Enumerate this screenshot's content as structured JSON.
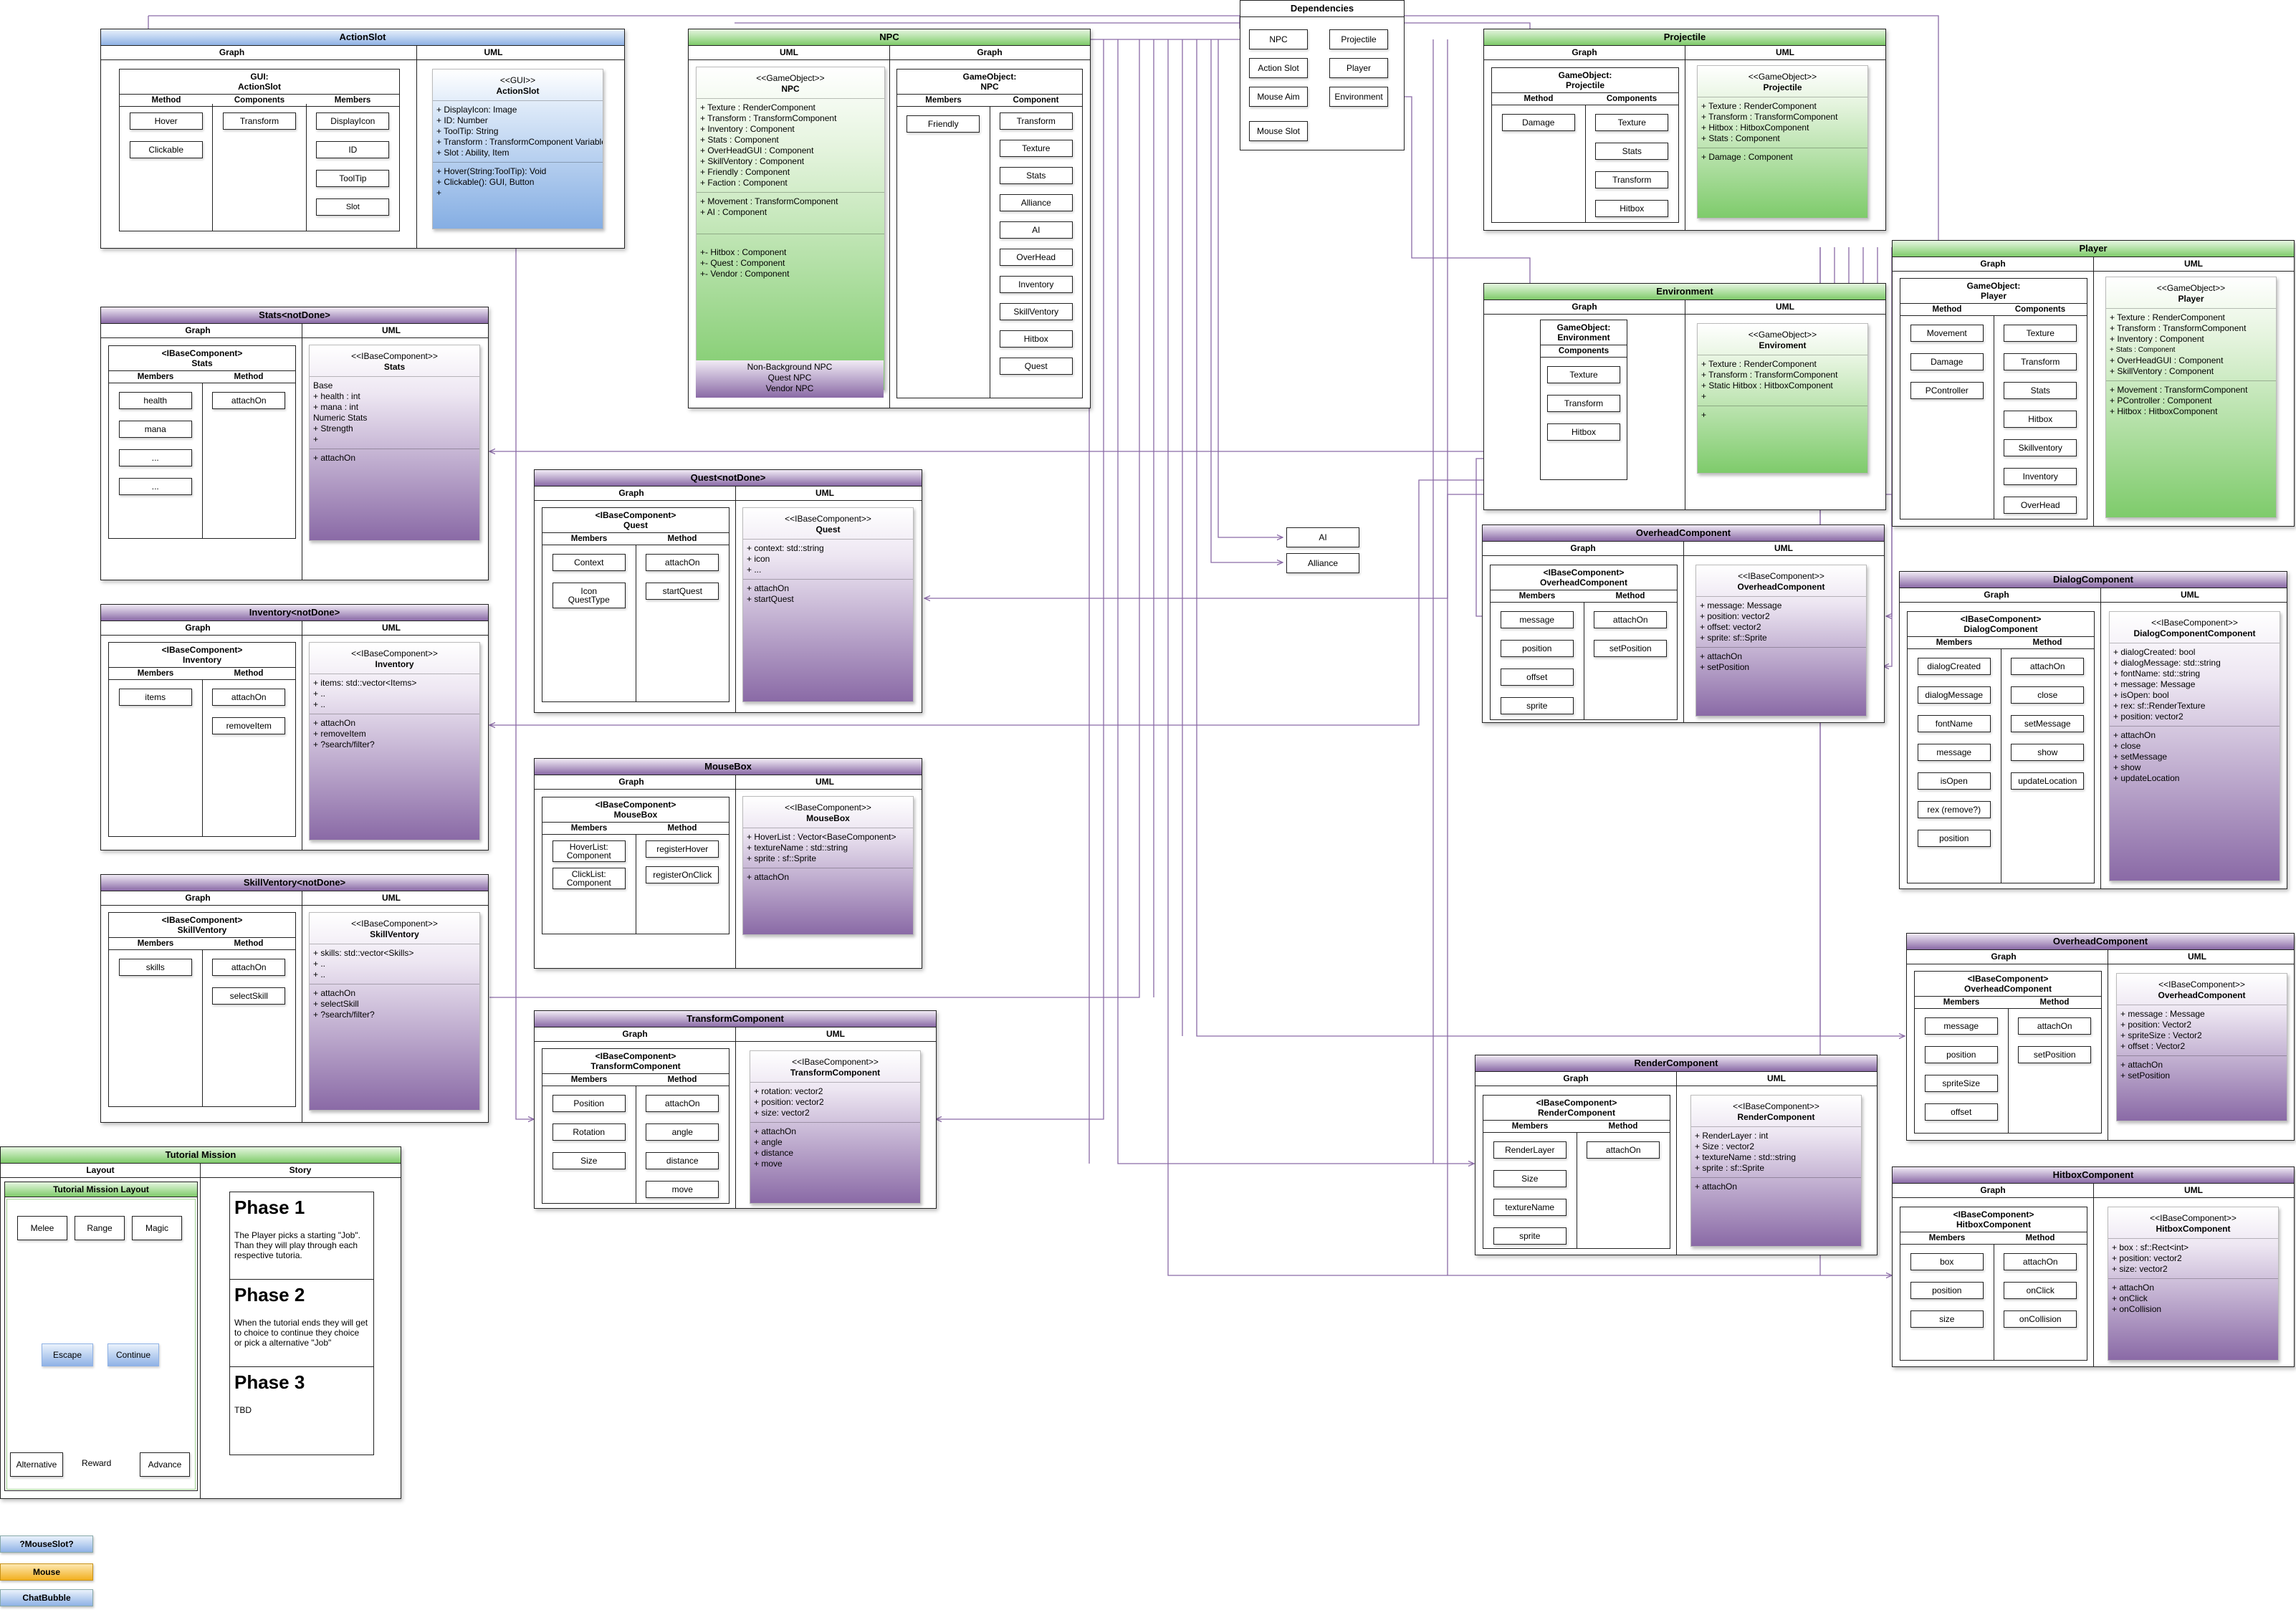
{
  "common": {
    "graph": "Graph",
    "uml": "UML",
    "layout": "Layout",
    "story": "Story"
  },
  "heads": {
    "method": "Method",
    "components": "Components",
    "members": "Members",
    "component": "Component"
  },
  "actionslot": {
    "title": "ActionSlot",
    "table_title": "GUI:\nActionSlot",
    "methods": [
      "Hover",
      "Clickable"
    ],
    "components": [
      "Transform"
    ],
    "members": [
      "DisplayIcon",
      "ID",
      "ToolTip",
      "Slot"
    ],
    "uml_stereo": "<<GUI>>",
    "uml_name": "ActionSlot",
    "attrs": [
      "+ DisplayIcon: Image",
      "+ ID: Number",
      "+ ToolTip: String",
      "+ Transform : TransformComponent Variable",
      "+ Slot : Ability, Item"
    ],
    "ops": [
      "+ Hover(String:ToolTip): Void",
      "+ Clickable(): GUI, Button",
      "+"
    ]
  },
  "npc": {
    "title": "NPC",
    "uml_stereo": "<<GameObject>>",
    "uml_name": "NPC",
    "attrs": [
      "+ Texture : RenderComponent",
      "+ Transform : TransformComponent",
      "+ Inventory : Component",
      "+ Stats : Component",
      "+ OverHeadGUI : Component",
      "+ SkillVentory : Component",
      "+ Friendly : Component",
      "+ Faction : Component"
    ],
    "ops": [
      "+ Movement : TransformComponent",
      "+ AI : Component"
    ],
    "extra": [
      "+- Hitbox : Component",
      "+- Quest : Component",
      "+- Vendor : Component"
    ],
    "footer": [
      "Non-Background NPC",
      "Quest NPC",
      "Vendor NPC"
    ],
    "table_title": "GameObject:\nNPC",
    "members": [
      "Friendly"
    ],
    "components": [
      "Transform",
      "Texture",
      "Stats",
      "Alliance",
      "AI",
      "OverHead",
      "Inventory",
      "SkillVentory",
      "Hitbox",
      "Quest"
    ]
  },
  "deps": {
    "title": "Dependencies",
    "items": [
      "NPC",
      "Projectile",
      "Action Slot",
      "Player",
      "Mouse Aim",
      "Environment",
      "Mouse Slot"
    ]
  },
  "projectile": {
    "title": "Projectile",
    "table_title": "GameObject:\nProjectile",
    "methods": [
      "Damage"
    ],
    "components": [
      "Texture",
      "Stats",
      "Transform",
      "Hitbox"
    ],
    "uml_stereo": "<<GameObject>>",
    "uml_name": "Projectile",
    "attrs": [
      "+ Texture : RenderComponent",
      "+ Transform : TransformComponent",
      "+ Hitbox : HitboxComponent",
      "+ Stats : Component"
    ],
    "ops": [
      "+ Damage : Component"
    ]
  },
  "player": {
    "title": "Player",
    "table_title": "GameObject:\nPlayer",
    "methods": [
      "Movement",
      "Damage",
      "PController"
    ],
    "components": [
      "Texture",
      "Transform",
      "Stats",
      "Hitbox",
      "Skillventory",
      "Inventory",
      "OverHead"
    ],
    "uml_stereo": "<<GameObject>>",
    "uml_name": "Player",
    "attrs": [
      "+ Texture : RenderComponent",
      "+ Transform : TransformComponent",
      "+ Inventory : Component",
      "+ Stats : Component",
      "+ OverHeadGUI : Component",
      "+ SkillVentory : Component"
    ],
    "ops": [
      "+ Movement : TransformComponent",
      "+ PController : Component",
      "+ Hitbox : HitboxComponent"
    ]
  },
  "environment": {
    "title": "Environment",
    "table_title": "GameObject:\nEnvironment",
    "components": [
      "Texture",
      "Transform",
      "Hitbox"
    ],
    "uml_stereo": "<<GameObject>>",
    "uml_name": "Enviroment",
    "attrs": [
      "+ Texture : RenderComponent",
      "+ Transform : TransformComponent",
      "+ Static Hitbox : HitboxComponent",
      "+"
    ],
    "ops": [
      "+"
    ]
  },
  "stats": {
    "title": "Stats<notDone>",
    "table_title": "<IBaseComponent>\nStats",
    "members": [
      "health",
      "mana",
      "...",
      "..."
    ],
    "methods": [
      "attachOn"
    ],
    "uml_stereo": "<<IBaseComponent>>",
    "uml_name": "Stats",
    "attrs": [
      "Base",
      "+ health : int",
      "+ mana : int",
      "Numeric Stats",
      "+ Strength",
      "+"
    ],
    "ops": [
      "+ attachOn"
    ]
  },
  "quest": {
    "title": "Quest<notDone>",
    "table_title": "<IBaseComponent>\nQuest",
    "members": [
      "Context",
      "Icon\nQuestType"
    ],
    "methods": [
      "attachOn",
      "startQuest"
    ],
    "uml_stereo": "<<IBaseComponent>>",
    "uml_name": "Quest",
    "attrs": [
      "+ context: std::string",
      "+ icon",
      "+ ..."
    ],
    "ops": [
      "+ attachOn",
      "+ startQuest"
    ]
  },
  "inventory": {
    "title": "Inventory<notDone>",
    "table_title": "<IBaseComponent>\nInventory",
    "members": [
      "items"
    ],
    "methods": [
      "attachOn",
      "removeItem"
    ],
    "uml_stereo": "<<IBaseComponent>>",
    "uml_name": "Inventory",
    "attrs": [
      "+ items: std::vector<Items>",
      "+ ..",
      "+ .."
    ],
    "ops": [
      "+ attachOn",
      "+ removeItem",
      "+ ?search/filter?"
    ]
  },
  "mousebox": {
    "title": "MouseBox",
    "table_title": "<IBaseComponent>\nMouseBox",
    "members": [
      "HoverList:\nComponent",
      "ClickList:\nComponent"
    ],
    "methods": [
      "registerHover",
      "registerOnClick"
    ],
    "uml_stereo": "<<IBaseComponent>>",
    "uml_name": "MouseBox",
    "attrs": [
      "+ HoverList : Vector<BaseComponent>",
      "+ textureName : std::string",
      "+ sprite : sf::Sprite"
    ],
    "ops": [
      "+ attachOn"
    ]
  },
  "skillventory": {
    "title": "SkillVentory<notDone>",
    "table_title": "<IBaseComponent>\nSkillVentory",
    "members": [
      "skills"
    ],
    "methods": [
      "attachOn",
      "selectSkill"
    ],
    "uml_stereo": "<<IBaseComponent>>",
    "uml_name": "SkillVentory",
    "attrs": [
      "+ skills: std::vector<Skills>",
      "+ ..",
      "+ .."
    ],
    "ops": [
      "+ attachOn",
      "+ selectSkill",
      "+ ?search/filter?"
    ]
  },
  "transform": {
    "title": "TransformComponent",
    "table_title": "<IBaseComponent>\nTransformComponent",
    "members": [
      "Position",
      "Rotation",
      "Size"
    ],
    "methods": [
      "attachOn",
      "angle",
      "distance",
      "move"
    ],
    "uml_stereo": "<<IBaseComponent>>",
    "uml_name": "TransformComponent",
    "attrs": [
      "+ rotation: vector2",
      "+ position: vector2",
      "+ size: vector2"
    ],
    "ops": [
      "+ attachOn",
      "+ angle",
      "+ distance",
      "+ move"
    ]
  },
  "overhead1": {
    "title": "OverheadComponent",
    "table_title": "<IBaseComponent>\nOverheadComponent",
    "members": [
      "message",
      "position",
      "offset",
      "sprite"
    ],
    "methods": [
      "attachOn",
      "setPosition"
    ],
    "uml_stereo": "<<IBaseComponent>>",
    "uml_name": "OverheadComponent",
    "attrs": [
      "+ message: Message",
      "+ position: vector2",
      "+ offset: vector2",
      "+ sprite: sf::Sprite"
    ],
    "ops": [
      "+ attachOn",
      "+ setPosition"
    ]
  },
  "dialog": {
    "title": "DialogComponent",
    "table_title": "<IBaseComponent>\nDialogComponent",
    "members": [
      "dialogCreated",
      "dialogMessage",
      "fontName",
      "message",
      "isOpen",
      "rex (remove?)",
      "position"
    ],
    "methods": [
      "attachOn",
      "close",
      "setMessage",
      "show",
      "updateLocation"
    ],
    "uml_stereo": "<<IBaseComponent>>",
    "uml_name": "DialogComponentComponent",
    "attrs": [
      "+ dialogCreated: bool",
      "+ dialogMessage: std::string",
      "+ fontName: std::string",
      "+ message: Message",
      "+ isOpen: bool",
      "+ rex: sf::RenderTexture",
      "+ position: vector2"
    ],
    "ops": [
      "+ attachOn",
      "+ close",
      "+ setMessage",
      "+ show",
      "+ updateLocation"
    ]
  },
  "overhead2": {
    "title": "OverheadComponent",
    "table_title": "<IBaseComponent>\nOverheadComponent",
    "members": [
      "message",
      "position",
      "spriteSize",
      "offset"
    ],
    "methods": [
      "attachOn",
      "setPosition"
    ],
    "uml_stereo": "<<IBaseComponent>>",
    "uml_name": "OverheadComponent",
    "attrs": [
      "+ message : Message",
      "+ position: Vector2",
      "+ spriteSize : Vector2",
      "+ offset : Vector2"
    ],
    "ops": [
      "+ attachOn",
      "+ setPosition"
    ]
  },
  "render": {
    "title": "RenderComponent",
    "table_title": "<IBaseComponent>\nRenderComponent",
    "members": [
      "RenderLayer",
      "Size",
      "textureName",
      "sprite"
    ],
    "methods": [
      "attachOn"
    ],
    "uml_stereo": "<<IBaseComponent>>",
    "uml_name": "RenderComponent",
    "attrs": [
      "+ RenderLayer : int",
      "+ Size : vector2",
      "+ textureName : std::string",
      "+ sprite : sf::Sprite"
    ],
    "ops": [
      "+ attachOn"
    ]
  },
  "hitbox": {
    "title": "HitboxComponent",
    "table_title": "<IBaseComponent>\nHitboxComponent",
    "members": [
      "box",
      "position",
      "size"
    ],
    "methods": [
      "attachOn",
      "onClick",
      "onCollision"
    ],
    "uml_stereo": "<<IBaseComponent>>",
    "uml_name": "HitboxComponent",
    "attrs": [
      "+ box : sf::Rect<int>",
      "+ position: vector2",
      "+ size: vector2"
    ],
    "ops": [
      "+ attachOn",
      "+ onClick",
      "+ onCollision"
    ]
  },
  "ai_label": "AI",
  "alliance_label": "Alliance",
  "tutorial": {
    "title": "Tutorial Mission",
    "layout_title": "Tutorial Mission Layout",
    "nodes": {
      "melee": "Melee",
      "range": "Range",
      "magic": "Magic",
      "escape": "Escape",
      "continue": "Continue",
      "alternative": "Alternative",
      "reward": "Reward",
      "advance": "Advance"
    },
    "phases": [
      {
        "title": "Phase 1",
        "text": "The Player picks a starting \"Job\". Than they will play through each respective tutoria."
      },
      {
        "title": "Phase 2",
        "text": "When the tutorial ends they will get to choice to continue they choice or pick a alternative \"Job\""
      },
      {
        "title": "Phase 3",
        "text": "TBD"
      }
    ]
  },
  "legend": [
    {
      "label": "?MouseSlot?",
      "color": "#8fb2e6"
    },
    {
      "label": "Mouse",
      "color": "#f2b020"
    },
    {
      "label": "ChatBubble",
      "color": "#8fb2e6"
    }
  ],
  "colors": {
    "wire": "#8a6aa6",
    "green": "#7fcb6a",
    "blue": "#8fb2e6",
    "purple": "#8a6aa6"
  }
}
